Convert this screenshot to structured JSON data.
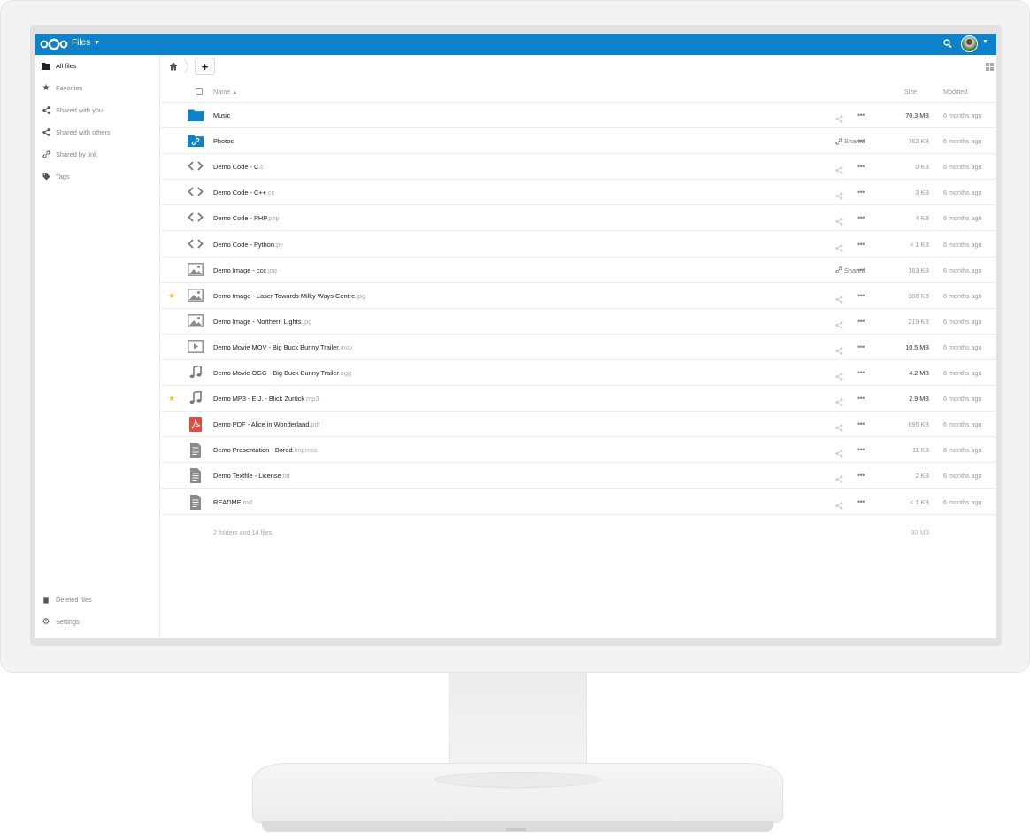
{
  "header": {
    "app_name": "Files",
    "brand_color": "#0e82c8"
  },
  "sidebar": {
    "items": [
      {
        "label": "All files",
        "icon": "folder-icon"
      },
      {
        "label": "Favorites",
        "icon": "star-icon"
      },
      {
        "label": "Shared with you",
        "icon": "share-icon"
      },
      {
        "label": "Shared with others",
        "icon": "share-icon"
      },
      {
        "label": "Shared by link",
        "icon": "link-icon"
      },
      {
        "label": "Tags",
        "icon": "tag-icon"
      }
    ],
    "bottom": [
      {
        "label": "Deleted files",
        "icon": "trash-icon"
      },
      {
        "label": "Settings",
        "icon": "gear-icon"
      }
    ]
  },
  "toolbar": {
    "new_label": "+"
  },
  "table": {
    "columns": {
      "name": "Name",
      "size": "Size",
      "modified": "Modified"
    },
    "rows": [
      {
        "name": "Music",
        "ext": "",
        "type": "folder",
        "favorite": false,
        "shared": "",
        "size": "70.3 MB",
        "modified": "6 months ago"
      },
      {
        "name": "Photos",
        "ext": "",
        "type": "folder-link",
        "favorite": false,
        "shared": "Shared",
        "size": "762 KB",
        "modified": "6 months ago"
      },
      {
        "name": "Demo Code - C",
        "ext": ".c",
        "type": "code",
        "favorite": false,
        "shared": "",
        "size": "0 KB",
        "modified": "6 months ago"
      },
      {
        "name": "Demo Code - C++",
        "ext": ".cc",
        "type": "code",
        "favorite": false,
        "shared": "",
        "size": "3 KB",
        "modified": "6 months ago"
      },
      {
        "name": "Demo Code - PHP",
        "ext": ".php",
        "type": "code",
        "favorite": false,
        "shared": "",
        "size": "4 KB",
        "modified": "6 months ago"
      },
      {
        "name": "Demo Code - Python",
        "ext": ".py",
        "type": "code",
        "favorite": false,
        "shared": "",
        "size": "< 1 KB",
        "modified": "6 months ago"
      },
      {
        "name": "Demo Image - ccc",
        "ext": ".jpg",
        "type": "image",
        "favorite": false,
        "shared": "Shared",
        "size": "163 KB",
        "modified": "6 months ago"
      },
      {
        "name": "Demo Image - Laser Towards Milky Ways Centre",
        "ext": ".jpg",
        "type": "image",
        "favorite": true,
        "shared": "",
        "size": "308 KB",
        "modified": "6 months ago"
      },
      {
        "name": "Demo Image - Northern Lights",
        "ext": ".jpg",
        "type": "image",
        "favorite": false,
        "shared": "",
        "size": "219 KB",
        "modified": "6 months ago"
      },
      {
        "name": "Demo Movie MOV - Big Buck Bunny Trailer",
        "ext": ".mov",
        "type": "video",
        "favorite": false,
        "shared": "",
        "size": "10.5 MB",
        "modified": "6 months ago"
      },
      {
        "name": "Demo Movie OGG - Big Buck Bunny Trailer",
        "ext": ".ogg",
        "type": "audio",
        "favorite": false,
        "shared": "",
        "size": "4.2 MB",
        "modified": "6 months ago"
      },
      {
        "name": "Demo MP3 - E.J. - Blick Zurück",
        "ext": ".mp3",
        "type": "audio",
        "favorite": true,
        "shared": "",
        "size": "2.9 MB",
        "modified": "6 months ago"
      },
      {
        "name": "Demo PDF - Alice in Wonderland",
        "ext": ".pdf",
        "type": "pdf",
        "favorite": false,
        "shared": "",
        "size": "695 KB",
        "modified": "6 months ago"
      },
      {
        "name": "Demo Presentation - Bored",
        "ext": ".impress",
        "type": "text",
        "favorite": false,
        "shared": "",
        "size": "11 KB",
        "modified": "6 months ago"
      },
      {
        "name": "Demo Textfile - License",
        "ext": ".txt",
        "type": "text",
        "favorite": false,
        "shared": "",
        "size": "2 KB",
        "modified": "6 months ago"
      },
      {
        "name": "README",
        "ext": ".md",
        "type": "text",
        "favorite": false,
        "shared": "",
        "size": "< 1 KB",
        "modified": "6 months ago"
      }
    ],
    "summary": "2 folders and 14 files",
    "summary_size": "90 MB"
  }
}
